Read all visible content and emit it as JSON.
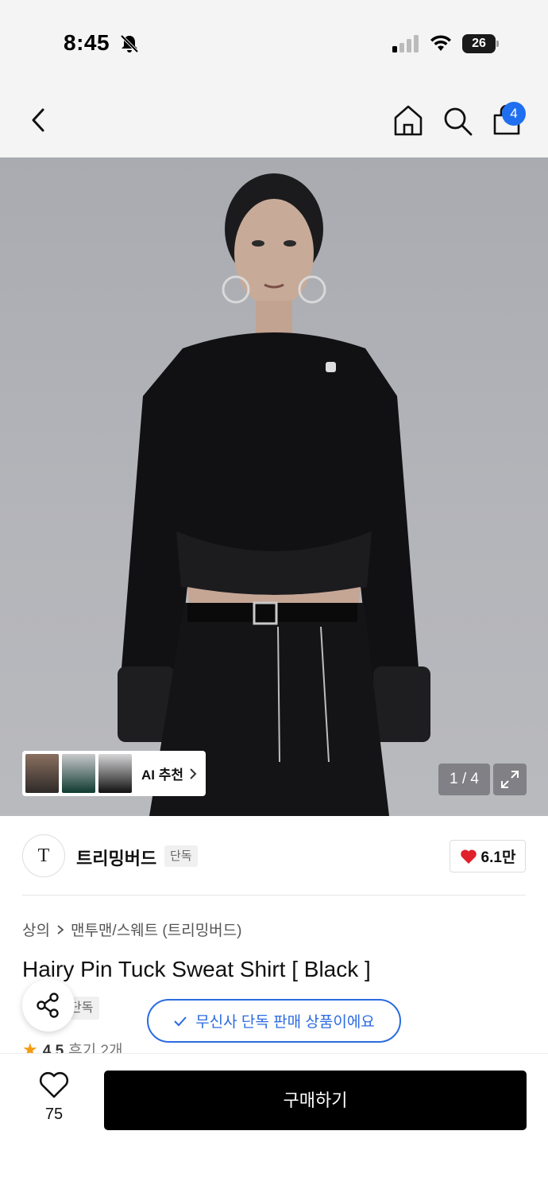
{
  "status_bar": {
    "time": "8:45",
    "battery": "26",
    "icons": [
      "bell-off-icon",
      "cellular-signal-icon",
      "wifi-icon",
      "battery-icon"
    ]
  },
  "nav": {
    "icons": [
      "back-icon",
      "home-icon",
      "search-icon",
      "shopping-bag-icon"
    ],
    "cart_count": "4"
  },
  "gallery": {
    "ai_recommend_label": "AI 추천",
    "page_indicator": "1 / 4",
    "image_index": 1,
    "image_count": 4
  },
  "brand": {
    "logo_text": "T",
    "name": "트리밍버드",
    "badge": "단독",
    "likes": "6.1만"
  },
  "product": {
    "breadcrumb": [
      "상의",
      "맨투맨/스웨트 (트리밍버드)"
    ],
    "title": "Hairy Pin Tuck Sweat Shirt [ Black ]",
    "exclusive_tag": "단독",
    "musinsa_notice": "무신사 단독 판매 상품이에요",
    "rating": "4.5",
    "reviews": "후기 2개"
  },
  "bottom_bar": {
    "like_count": "75",
    "buy_label": "구매하기"
  },
  "colors": {
    "accent_blue": "#2b6be0",
    "badge_blue": "#1f6ff0",
    "heart_red": "#e0202a",
    "star_orange": "#f39c12",
    "buy_black": "#000000"
  }
}
